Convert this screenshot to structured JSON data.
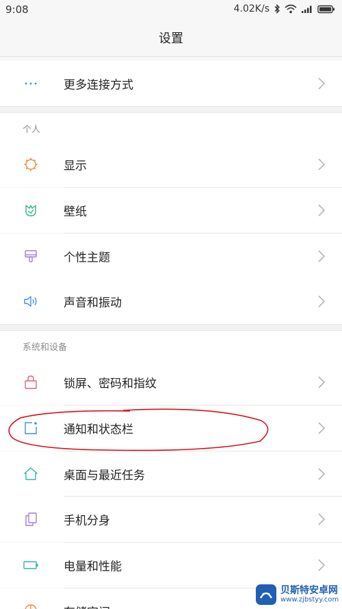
{
  "status_bar": {
    "time": "9:08",
    "speed": "4.02K/s"
  },
  "header": {
    "title": "设置"
  },
  "connections": {
    "more_connections": "更多连接方式"
  },
  "personal": {
    "title": "个人",
    "items": [
      {
        "label": "显示",
        "icon": "brightness-icon"
      },
      {
        "label": "壁纸",
        "icon": "tulip-icon"
      },
      {
        "label": "个性主题",
        "icon": "paint-brush-icon"
      },
      {
        "label": "声音和振动",
        "icon": "speaker-icon"
      }
    ]
  },
  "system": {
    "title": "系统和设备",
    "items": [
      {
        "label": "锁屏、密码和指纹",
        "icon": "lock-icon"
      },
      {
        "label": "通知和状态栏",
        "icon": "notification-icon"
      },
      {
        "label": "桌面与最近任务",
        "icon": "home-icon"
      },
      {
        "label": "手机分身",
        "icon": "dual-phone-icon"
      },
      {
        "label": "电量和性能",
        "icon": "battery-icon"
      },
      {
        "label": "存储空间",
        "icon": "storage-icon"
      }
    ]
  },
  "colors": {
    "accent_blue": "#3a8ee6",
    "orange": "#f08a3c",
    "green": "#35b08c",
    "purple": "#a27be0",
    "pink": "#e0607a",
    "teal": "#2fb7a8",
    "annotation_red": "#d8101a"
  },
  "watermark": {
    "name": "贝斯特安卓网",
    "url": "www.zjbstyy.com"
  }
}
